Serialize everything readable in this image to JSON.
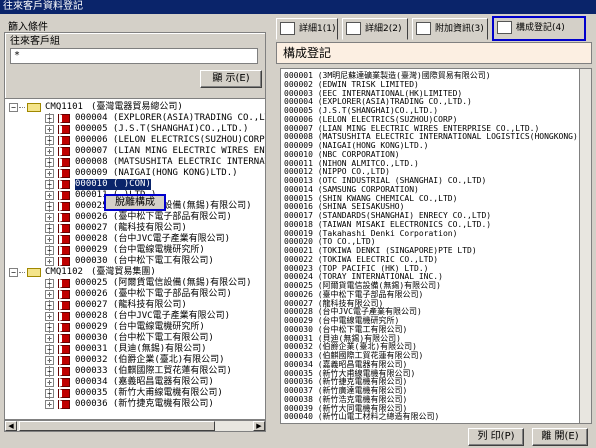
{
  "window": {
    "title": "往來客戶資料登記"
  },
  "conditions": {
    "title": "篩入條件",
    "customer_group_label": "往來客戶組",
    "customer_group_value": "*",
    "show_button": "顯 示(E)"
  },
  "tree": {
    "groups": [
      {
        "code": "CMQ1101",
        "name": "(臺灣電器貿易總公司)",
        "items": [
          "000004 (EXPLORER(ASIA)TRADING CO.,LTD.)",
          "000005 (J.S.T(SHANGHAI)CO.,LTD.)",
          "000006 (LELON ELECTRICS(SUZHOU)CORP)",
          "000007 (LIAN MING ELECTRIC WIRES ENTERPR",
          "000008 (MATSUSHITA ELECTRIC INTERNATION",
          "000009 (NAIGAI(HONG KONG)LTD.)",
          "000010 (                    )CON)",
          "000011 (                    )LTD.)",
          "000025 (阿爾貨電信設備(無錫)有限公司)",
          "000026 (臺中松下電子部品有限公司)",
          "000027 (龍科技有限公司)",
          "000028 (台中JVC電子產業有限公司)",
          "000029 (台中電線電機研究所)",
          "000030 (台中松下電工有限公司)"
        ]
      },
      {
        "code": "CMQ1102",
        "name": "(臺灣貿易集團)",
        "items": [
          "000025 (阿爾貨電信設備(無錫)有限公司)",
          "000026 (臺中松下電子部品有限公司)",
          "000027 (龍科技有限公司)",
          "000028 (台中JVC電子產業有限公司)",
          "000029 (台中電線電機研究所)",
          "000030 (台中松下電工有限公司)",
          "000031 (貝迪(無錫)有限公司)",
          "000032 (伯爵企業(臺北)有限公司)",
          "000033 (伯麒國際工貿花蓮有限公司)",
          "000034 (嘉義昭昌電器有限公司)",
          "000035 (新竹大甫線電機有限公司)",
          "000036 (新竹捷克電機有限公司)"
        ]
      }
    ],
    "selected_item": "000010",
    "context_menu_item": "脫離構成"
  },
  "tabs": [
    {
      "label": "詳細1(1)",
      "icon": "book-icon"
    },
    {
      "label": "詳細2(2)",
      "icon": "book-icon"
    },
    {
      "label": "附加資訊(3)",
      "icon": "memo-icon"
    },
    {
      "label": "構成登記(4)",
      "icon": "book-icon"
    }
  ],
  "active_tab": "構成登記(4)",
  "composition": {
    "heading": "構成登記",
    "rows": [
      "000001 (3M明尼蘇達礦業製造(臺灣)國際貿易有限公司)",
      "000002 (EDWIN TRISK LIMITED)",
      "000003 (EEC INTERNATIONAL(HK)LIMITED)",
      "000004 (EXPLORER(ASIA)TRADING CO.,LTD.)",
      "000005 (J.S.T(SHANGHAI)CO.,LTD.)",
      "000006 (LELON ELECTRICS(SUZHOU)CORP)",
      "000007 (LIAN MING ELECTRIC WIRES ENTERPRISE CO.,LTD.)",
      "000008 (MATSUSHITA ELECTRIC INTERNATIONAL LOGISTICS(HONGKONG)",
      "000009 (NAIGAI(HONG KONG)LTD.)",
      "000010 (NBC CORPORATION)",
      "000011 (NIHON ALMITCO.,LTD.)",
      "000012 (NIPPO CO.,LTD)",
      "000013 (OTC INDUSTRIAL (SHANGHAI) CO.,LTD)",
      "000014 (SAMSUNG CORPORATION)",
      "000015 (SHIN KWANG CHEMICAL CO.,LTD)",
      "000016 (SHINA SEISAKUSHO)",
      "000017 (STANDARDS(SHANGHAI) ENRECY CO.,LTD)",
      "000018 (TAIWAN MISAKI ELECTRONICS CO.,LTD.)",
      "000019 (Takahashi Denki Corporation)",
      "000020 (TO CO.,LTD)",
      "000021 (TOKIWA DENKI (SINGAPORE)PTE LTD)",
      "000022 (TOKIWA ELECTRIC CO.,LTD)",
      "000023 (TOP PACIFIC (HK) LTD.)",
      "000024 (TORAY INTERNATIONAL INC.)",
      "000025 (阿爾貨電信設備(無錫)有限公司)",
      "000026 (臺中松下電子部品有限公司)",
      "000027 (龍科技有限公司)",
      "000028 (台中JVC電子產業有限公司)",
      "000029 (台中電線電機研究所)",
      "000030 (台中松下電工有限公司)",
      "000031 (貝迪(無錫)有限公司)",
      "000032 (伯爵企業(臺北)有限公司)",
      "000033 (伯麒國際工貿花蓮有限公司)",
      "000034 (嘉義昭昌電器有限公司)",
      "000035 (新竹大甫線電機有限公司)",
      "000036 (新竹捷克電機有限公司)",
      "000037 (新竹廣達電機有限公司)",
      "000038 (新竹浩克電機有限公司)",
      "000039 (新竹大同電機有限公司)",
      "000040 (新竹山電工材料之總造有限公司)"
    ]
  },
  "footer": {
    "print_button": "列 印(P)",
    "close_button": "離 開(E)"
  }
}
